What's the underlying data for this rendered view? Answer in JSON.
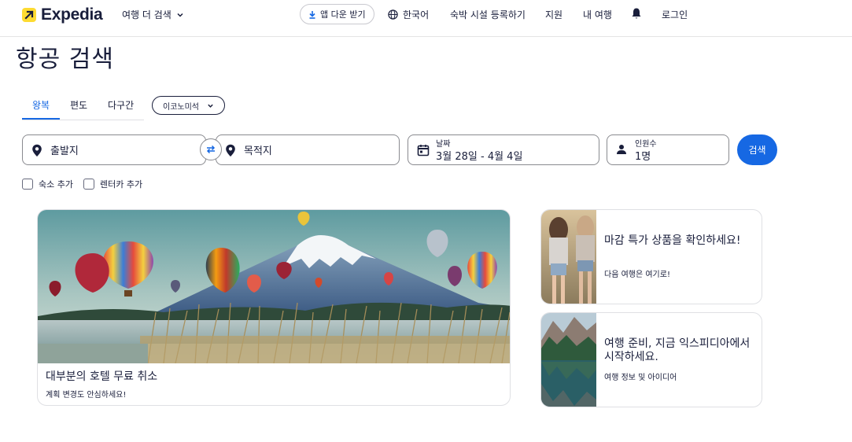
{
  "header": {
    "logo_text": "Expedia",
    "more_travel": "여행 더 검색",
    "app_download": "앱 다운 받기",
    "language": "한국어",
    "list_property": "숙박 시설 등록하기",
    "support": "지원",
    "my_trips": "내 여행",
    "login": "로그인"
  },
  "page": {
    "title": "항공 검색"
  },
  "tabs": [
    {
      "label": "왕복",
      "active": true
    },
    {
      "label": "편도",
      "active": false
    },
    {
      "label": "다구간",
      "active": false
    }
  ],
  "cabin": {
    "selected": "이코노미석"
  },
  "search": {
    "origin_placeholder": "출발지",
    "destination_placeholder": "목적지",
    "dates_label": "날짜",
    "dates_value": "3월 28일 - 4월 4일",
    "travelers_label": "인원수",
    "travelers_value": "1명",
    "search_button": "검색"
  },
  "options": {
    "add_stay": "숙소 추가",
    "add_car": "렌터카 추가"
  },
  "cards": {
    "hero": {
      "title": "대부분의 호텔 무료 취소",
      "subtitle": "계획 변경도 안심하세요!"
    },
    "deals": {
      "title": "마감 특가 상품을 확인하세요!",
      "subtitle": "다음 여행은 여기로!"
    },
    "guide": {
      "title": "여행 준비, 지금 익스피디아에서 시작하세요.",
      "subtitle": "여행 정보 및 아이디어"
    }
  },
  "colors": {
    "brand_blue": "#1668e3",
    "logo_yellow": "#fddb32",
    "text_dark": "#191e3b"
  },
  "icons": [
    "expedia-logo-icon",
    "chevron-down-icon",
    "download-icon",
    "globe-icon",
    "bell-icon",
    "location-pin-icon",
    "swap-icon",
    "calendar-icon",
    "person-icon"
  ]
}
